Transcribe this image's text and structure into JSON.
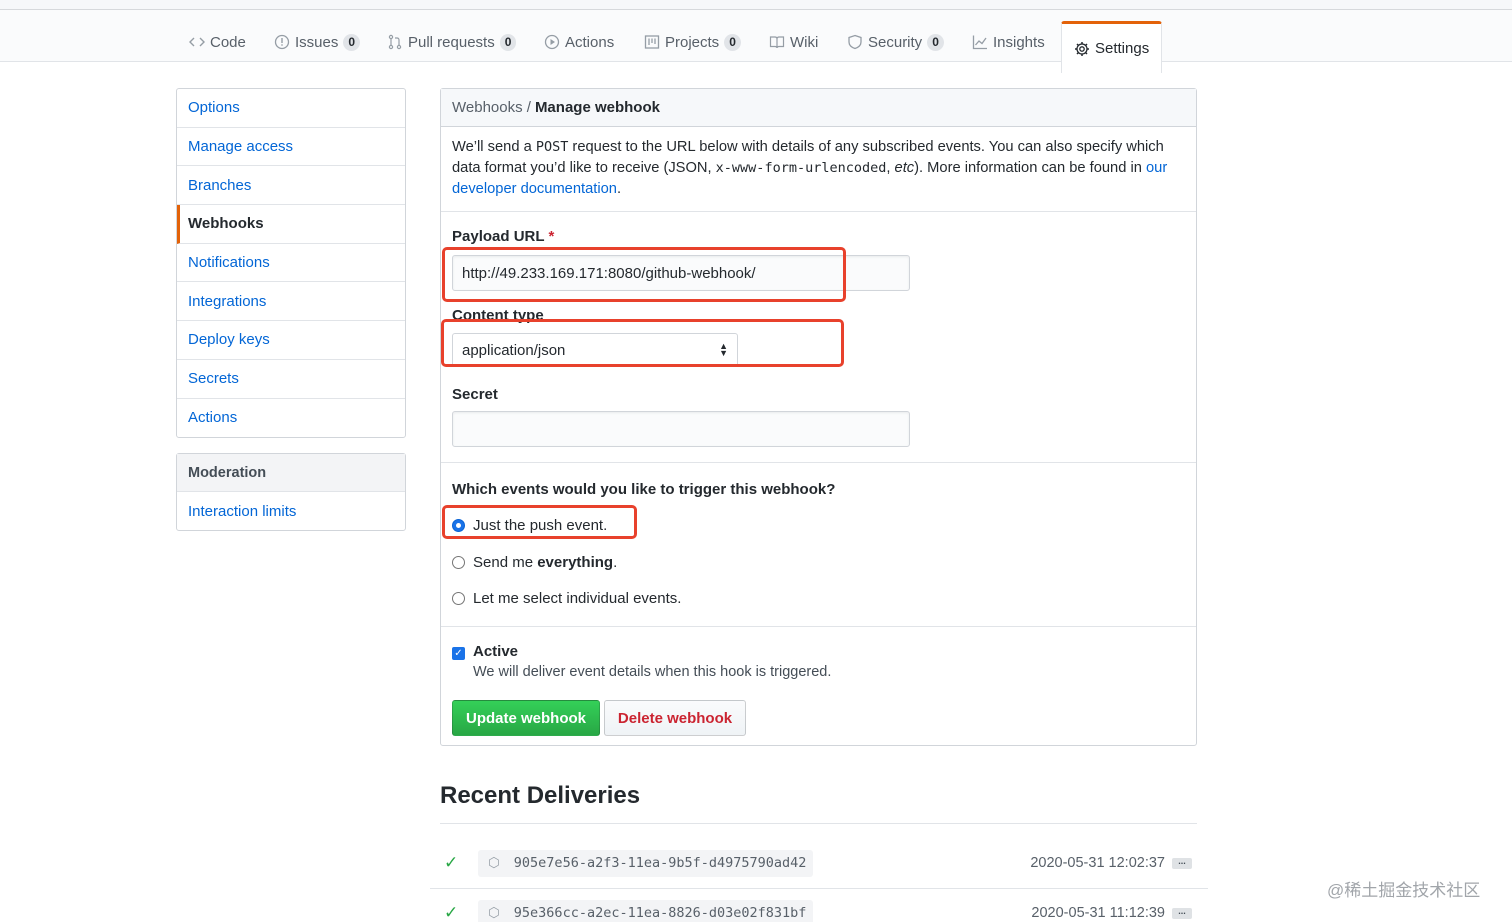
{
  "nav": {
    "tabs": [
      {
        "label": "Code",
        "count": null,
        "icon": "code-icon"
      },
      {
        "label": "Issues",
        "count": "0",
        "icon": "issue-opened-icon"
      },
      {
        "label": "Pull requests",
        "count": "0",
        "icon": "git-pull-request-icon"
      },
      {
        "label": "Actions",
        "count": null,
        "icon": "play-icon"
      },
      {
        "label": "Projects",
        "count": "0",
        "icon": "project-icon"
      },
      {
        "label": "Wiki",
        "count": null,
        "icon": "book-icon"
      },
      {
        "label": "Security",
        "count": "0",
        "icon": "shield-icon"
      },
      {
        "label": "Insights",
        "count": null,
        "icon": "graph-icon"
      },
      {
        "label": "Settings",
        "count": null,
        "icon": "gear-icon",
        "selected": true
      }
    ]
  },
  "sidebar": {
    "items": [
      "Options",
      "Manage access",
      "Branches",
      "Webhooks",
      "Notifications",
      "Integrations",
      "Deploy keys",
      "Secrets",
      "Actions"
    ],
    "selected": "Webhooks",
    "moderation": {
      "heading": "Moderation",
      "items": [
        "Interaction limits"
      ]
    }
  },
  "webhook": {
    "breadcrumb_parent": "Webhooks /",
    "breadcrumb_current": "Manage webhook",
    "intro_1": "We’ll send a ",
    "intro_post": "POST",
    "intro_2": " request to the URL below with details of any subscribed events. You can also specify which data format you’d like to receive (JSON, ",
    "intro_code": "x-www-form-urlencoded",
    "intro_3": ", ",
    "intro_etc": "etc",
    "intro_4": "). More information can be found in ",
    "intro_link": "our developer documentation",
    "intro_5": ".",
    "payload_label": "Payload URL",
    "required_mark": "*",
    "payload_value": "http://49.233.169.171:8080/github-webhook/",
    "content_type_label": "Content type",
    "content_type_value": "application/json",
    "secret_label": "Secret",
    "secret_value": "",
    "events_question": "Which events would you like to trigger this webhook?",
    "event_push": "Just the push event.",
    "event_all_prefix": "Send me ",
    "event_all_bold": "everything",
    "event_all_suffix": ".",
    "event_select": "Let me select individual events.",
    "selected_event": "push",
    "active_label": "Active",
    "active_checked": true,
    "active_note": "We will deliver event details when this hook is triggered.",
    "update_button": "Update webhook",
    "delete_button": "Delete webhook"
  },
  "recent": {
    "title": "Recent Deliveries",
    "deliveries": [
      {
        "guid": "905e7e56-a2f3-11ea-9b5f-d4975790ad42",
        "time": "2020-05-31 12:02:37"
      },
      {
        "guid": "95e366cc-a2ec-11ea-8826-d03e02f831bf",
        "time": "2020-05-31 11:12:39"
      }
    ]
  },
  "watermark": "@稀土掘金技术社区",
  "colors": {
    "accent": "#e36209",
    "link": "#0366d6",
    "primary_button": "#28a745",
    "danger": "#cb2431",
    "highlight": "#e8412c"
  }
}
